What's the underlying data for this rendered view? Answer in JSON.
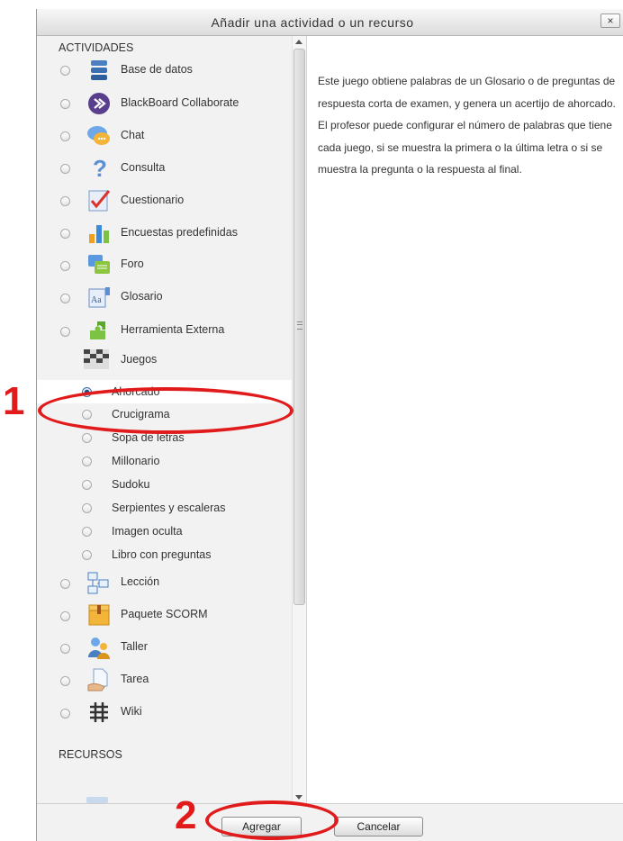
{
  "dialog": {
    "title": "Añadir una actividad o un recurso",
    "close_label": "×"
  },
  "sections": {
    "activities": "ACTIVIDADES",
    "resources": "RECURSOS"
  },
  "activities": [
    {
      "label": "Base de datos",
      "icon": "database-icon"
    },
    {
      "label": "BlackBoard Collaborate",
      "icon": "collaborate-icon"
    },
    {
      "label": "Chat",
      "icon": "chat-icon"
    },
    {
      "label": "Consulta",
      "icon": "question-icon"
    },
    {
      "label": "Cuestionario",
      "icon": "quiz-icon"
    },
    {
      "label": "Encuestas predefinidas",
      "icon": "survey-chart-icon"
    },
    {
      "label": "Foro",
      "icon": "forum-icon"
    },
    {
      "label": "Glosario",
      "icon": "glossary-icon"
    },
    {
      "label": "Herramienta Externa",
      "icon": "puzzle-icon"
    }
  ],
  "games": {
    "label": "Juegos",
    "icon": "games-icon",
    "selected": "Ahorcado",
    "items": [
      "Ahorcado",
      "Crucigrama",
      "Sopa de letras",
      "Millonario",
      "Sudoku",
      "Serpientes y escaleras",
      "Imagen oculta",
      "Libro con preguntas"
    ]
  },
  "activities_after": [
    {
      "label": "Lección",
      "icon": "lesson-icon"
    },
    {
      "label": "Paquete SCORM",
      "icon": "scorm-package-icon"
    },
    {
      "label": "Taller",
      "icon": "workshop-icon"
    },
    {
      "label": "Tarea",
      "icon": "assignment-icon"
    },
    {
      "label": "Wiki",
      "icon": "wiki-icon"
    }
  ],
  "description": "Este juego obtiene palabras de un Glosario o de preguntas de respuesta corta de examen, y genera un acertijo de ahorcado. El profesor puede configurar el número de palabras que tiene cada juego, si se muestra la primera o la última letra o si se muestra la pregunta o la respuesta al final.",
  "buttons": {
    "add": "Agregar",
    "cancel": "Cancelar"
  },
  "annotations": {
    "step1": "1",
    "step2": "2",
    "color": "#e11b1b"
  }
}
